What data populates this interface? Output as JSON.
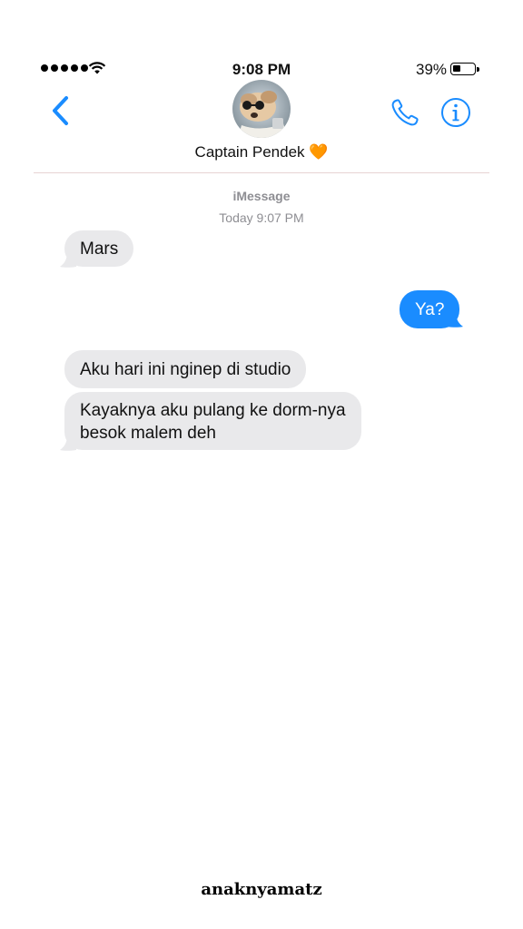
{
  "status_bar": {
    "time": "9:08 PM",
    "battery_percent": "39%",
    "battery_level": 0.39,
    "signal_bars": 5
  },
  "header": {
    "back_icon": "chevron-left-icon",
    "contact_name": "Captain Pendek",
    "contact_emoji": "🧡",
    "call_icon": "phone-icon",
    "info_icon": "info-icon",
    "accent_color": "#1a8cff"
  },
  "conversation": {
    "service_label": "iMessage",
    "timestamp": "Today 9:07 PM",
    "messages": [
      {
        "direction": "received",
        "text": "Mars"
      },
      {
        "direction": "sent",
        "text": "Ya?"
      },
      {
        "direction": "received",
        "text": "Aku hari ini nginep di studio"
      },
      {
        "direction": "received",
        "text_line1": "Kayaknya aku pulang ke dorm-nya",
        "text_line2": "besok malem deh"
      }
    ]
  },
  "colors": {
    "received_bubble": "#e9e9eb",
    "sent_bubble": "#1a8cff",
    "meta_text": "#8e8e93"
  },
  "watermark": "anaknyamatz"
}
